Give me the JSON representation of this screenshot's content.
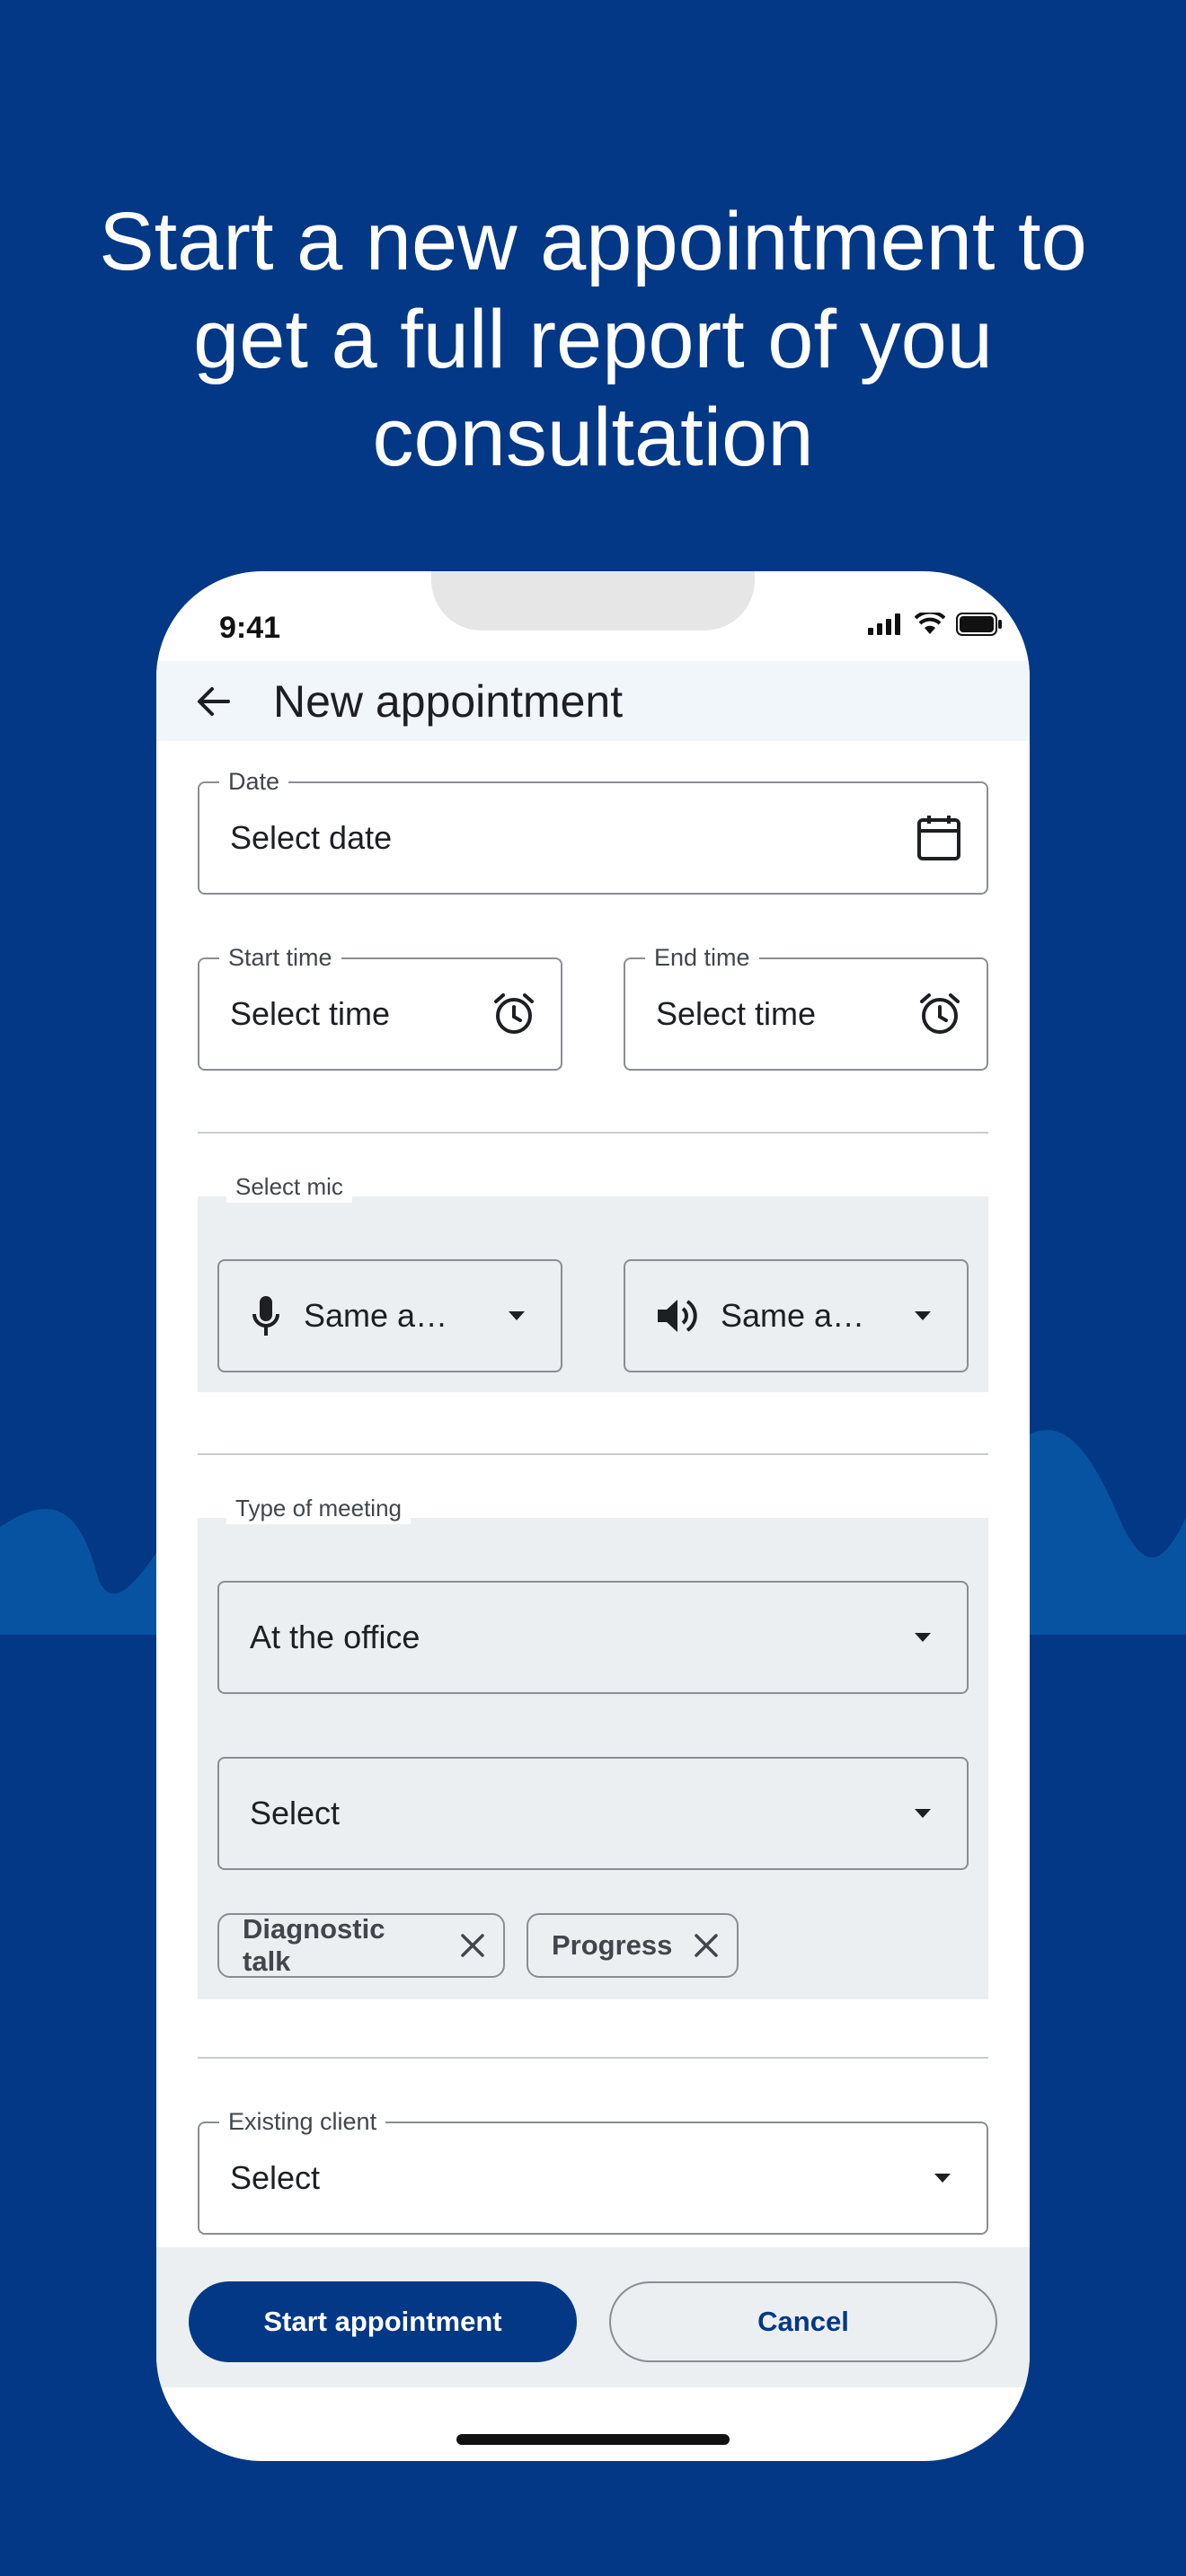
{
  "headline": "Start a new appointment to get a full report of you consultation",
  "status_bar": {
    "time": "9:41"
  },
  "app_bar": {
    "title": "New appointment"
  },
  "date_field": {
    "label": "Date",
    "value": "Select date"
  },
  "start_time_field": {
    "label": "Start time",
    "value": "Select time"
  },
  "end_time_field": {
    "label": "End time",
    "value": "Select time"
  },
  "mic_section": {
    "label": "Select mic",
    "input_select": "Same a…",
    "output_select": "Same a…"
  },
  "meeting_section": {
    "label": "Type of meeting",
    "location_select": "At the office",
    "type_select": "Select",
    "chips": [
      {
        "label": "Diagnostic talk"
      },
      {
        "label": "Progress"
      }
    ]
  },
  "client_field": {
    "label": "Existing client",
    "value": "Select"
  },
  "actions": {
    "start": "Start appointment",
    "cancel": "Cancel"
  },
  "colors": {
    "brand": "#023886",
    "surface": "#ebeff2",
    "appbar": "#f1f6fa"
  }
}
